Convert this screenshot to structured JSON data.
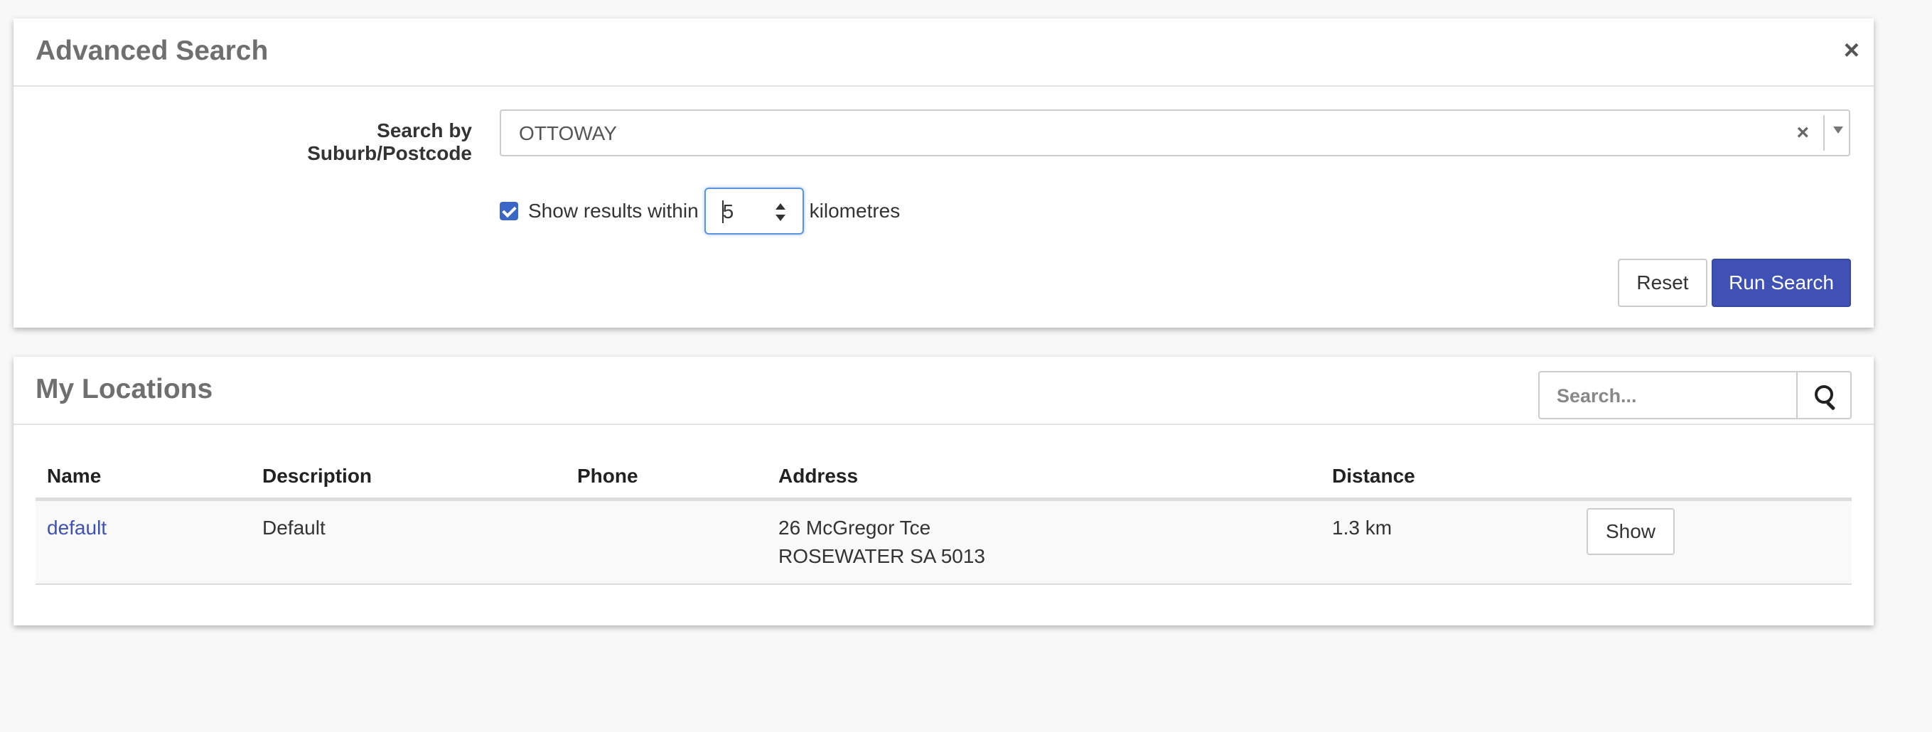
{
  "advanced_search": {
    "title": "Advanced Search",
    "close_label": "×",
    "suburb_label": "Search by Suburb/Postcode",
    "suburb_value": "OTTOWAY",
    "clear_label": "×",
    "within_checked": true,
    "within_prefix": "Show results within",
    "within_value": "5",
    "within_suffix": "kilometres",
    "reset_label": "Reset",
    "run_label": "Run Search"
  },
  "my_locations": {
    "title": "My Locations",
    "search_placeholder": "Search...",
    "columns": [
      "Name",
      "Description",
      "Phone",
      "Address",
      "Distance",
      ""
    ],
    "rows": [
      {
        "name": "default",
        "description": "Default",
        "phone": "",
        "address_line1": "26 McGregor Tce",
        "address_line2": "ROSEWATER SA 5013",
        "distance": "1.3 km",
        "action_label": "Show"
      }
    ]
  },
  "colors": {
    "primary": "#3f51b5",
    "checkbox": "#3a66c6",
    "focus_border": "#5b95e0"
  }
}
